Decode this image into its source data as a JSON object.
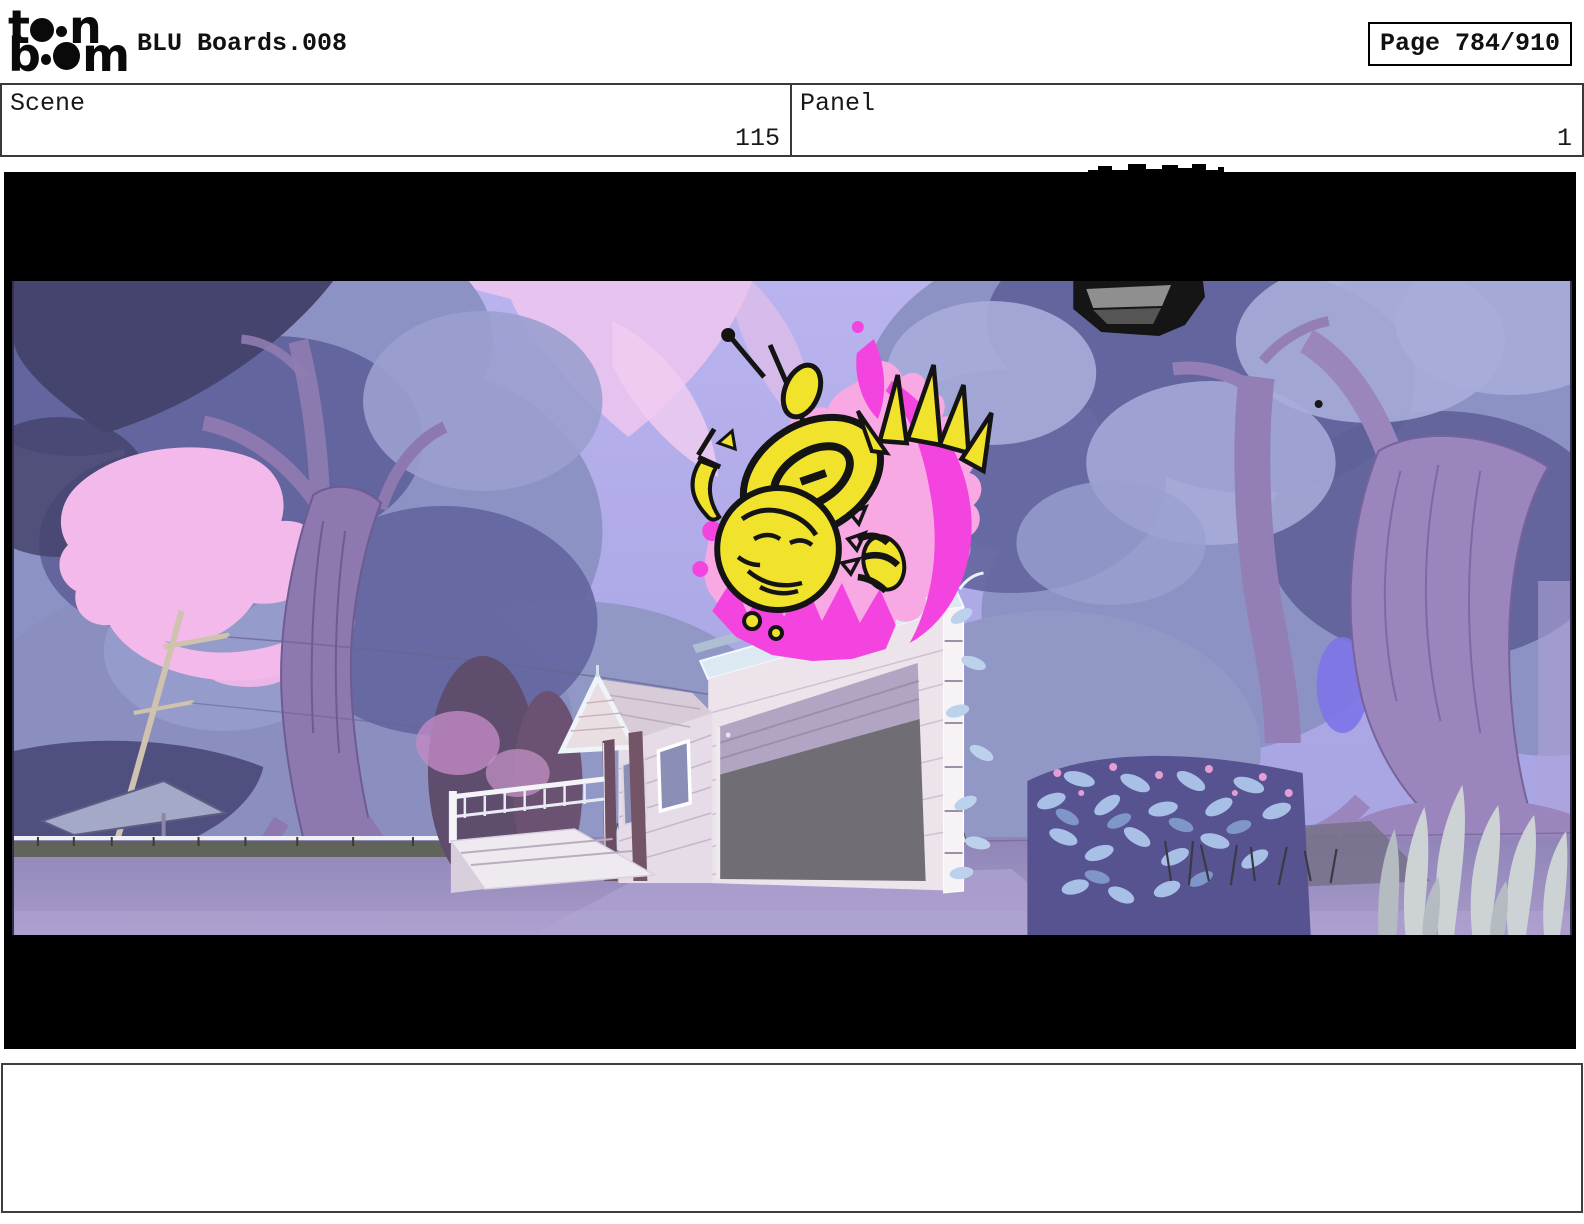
{
  "header": {
    "logo": {
      "brand": "toon boom",
      "line1_left": "t",
      "line1_right": "n",
      "line2_left": "b",
      "line2_right": "m"
    },
    "title": "BLU Boards.008",
    "page_badge": "Page 784/910"
  },
  "info_row": {
    "scene": {
      "label": "Scene",
      "value": "115"
    },
    "panel": {
      "label": "Panel",
      "value": "1"
    }
  },
  "storyboard": {
    "caption": ""
  },
  "colors": {
    "letterbox": "#000000",
    "border_dark": "#3a3a3a",
    "sky_top": "#b9b3ee",
    "sky_bottom": "#a7a3e2",
    "pink_cloud": "#efc6ee",
    "pink_cloud_left": "#f3b9eb",
    "foliage_light": "#8d92c4",
    "foliage_mid": "#63659e",
    "foliage_navy": "#45446f",
    "trunk_purple": "#9a85bc",
    "bright_blue": "#7d74e8",
    "house_wall": "#ece3eb",
    "roof_trim": "#dce9f3",
    "garage_interior": "#706d74",
    "garage_door": "#b2a5c3",
    "splash_soft_pink": "#f8a9e4",
    "splash_magenta": "#f444e0",
    "character_yellow": "#f1e32b",
    "ground_lavender": "#9a8cc0",
    "bush_leaf_blue": "#a9c0e6",
    "grass_white": "#cdd2d4",
    "object_gray": "#8f8f8f"
  }
}
